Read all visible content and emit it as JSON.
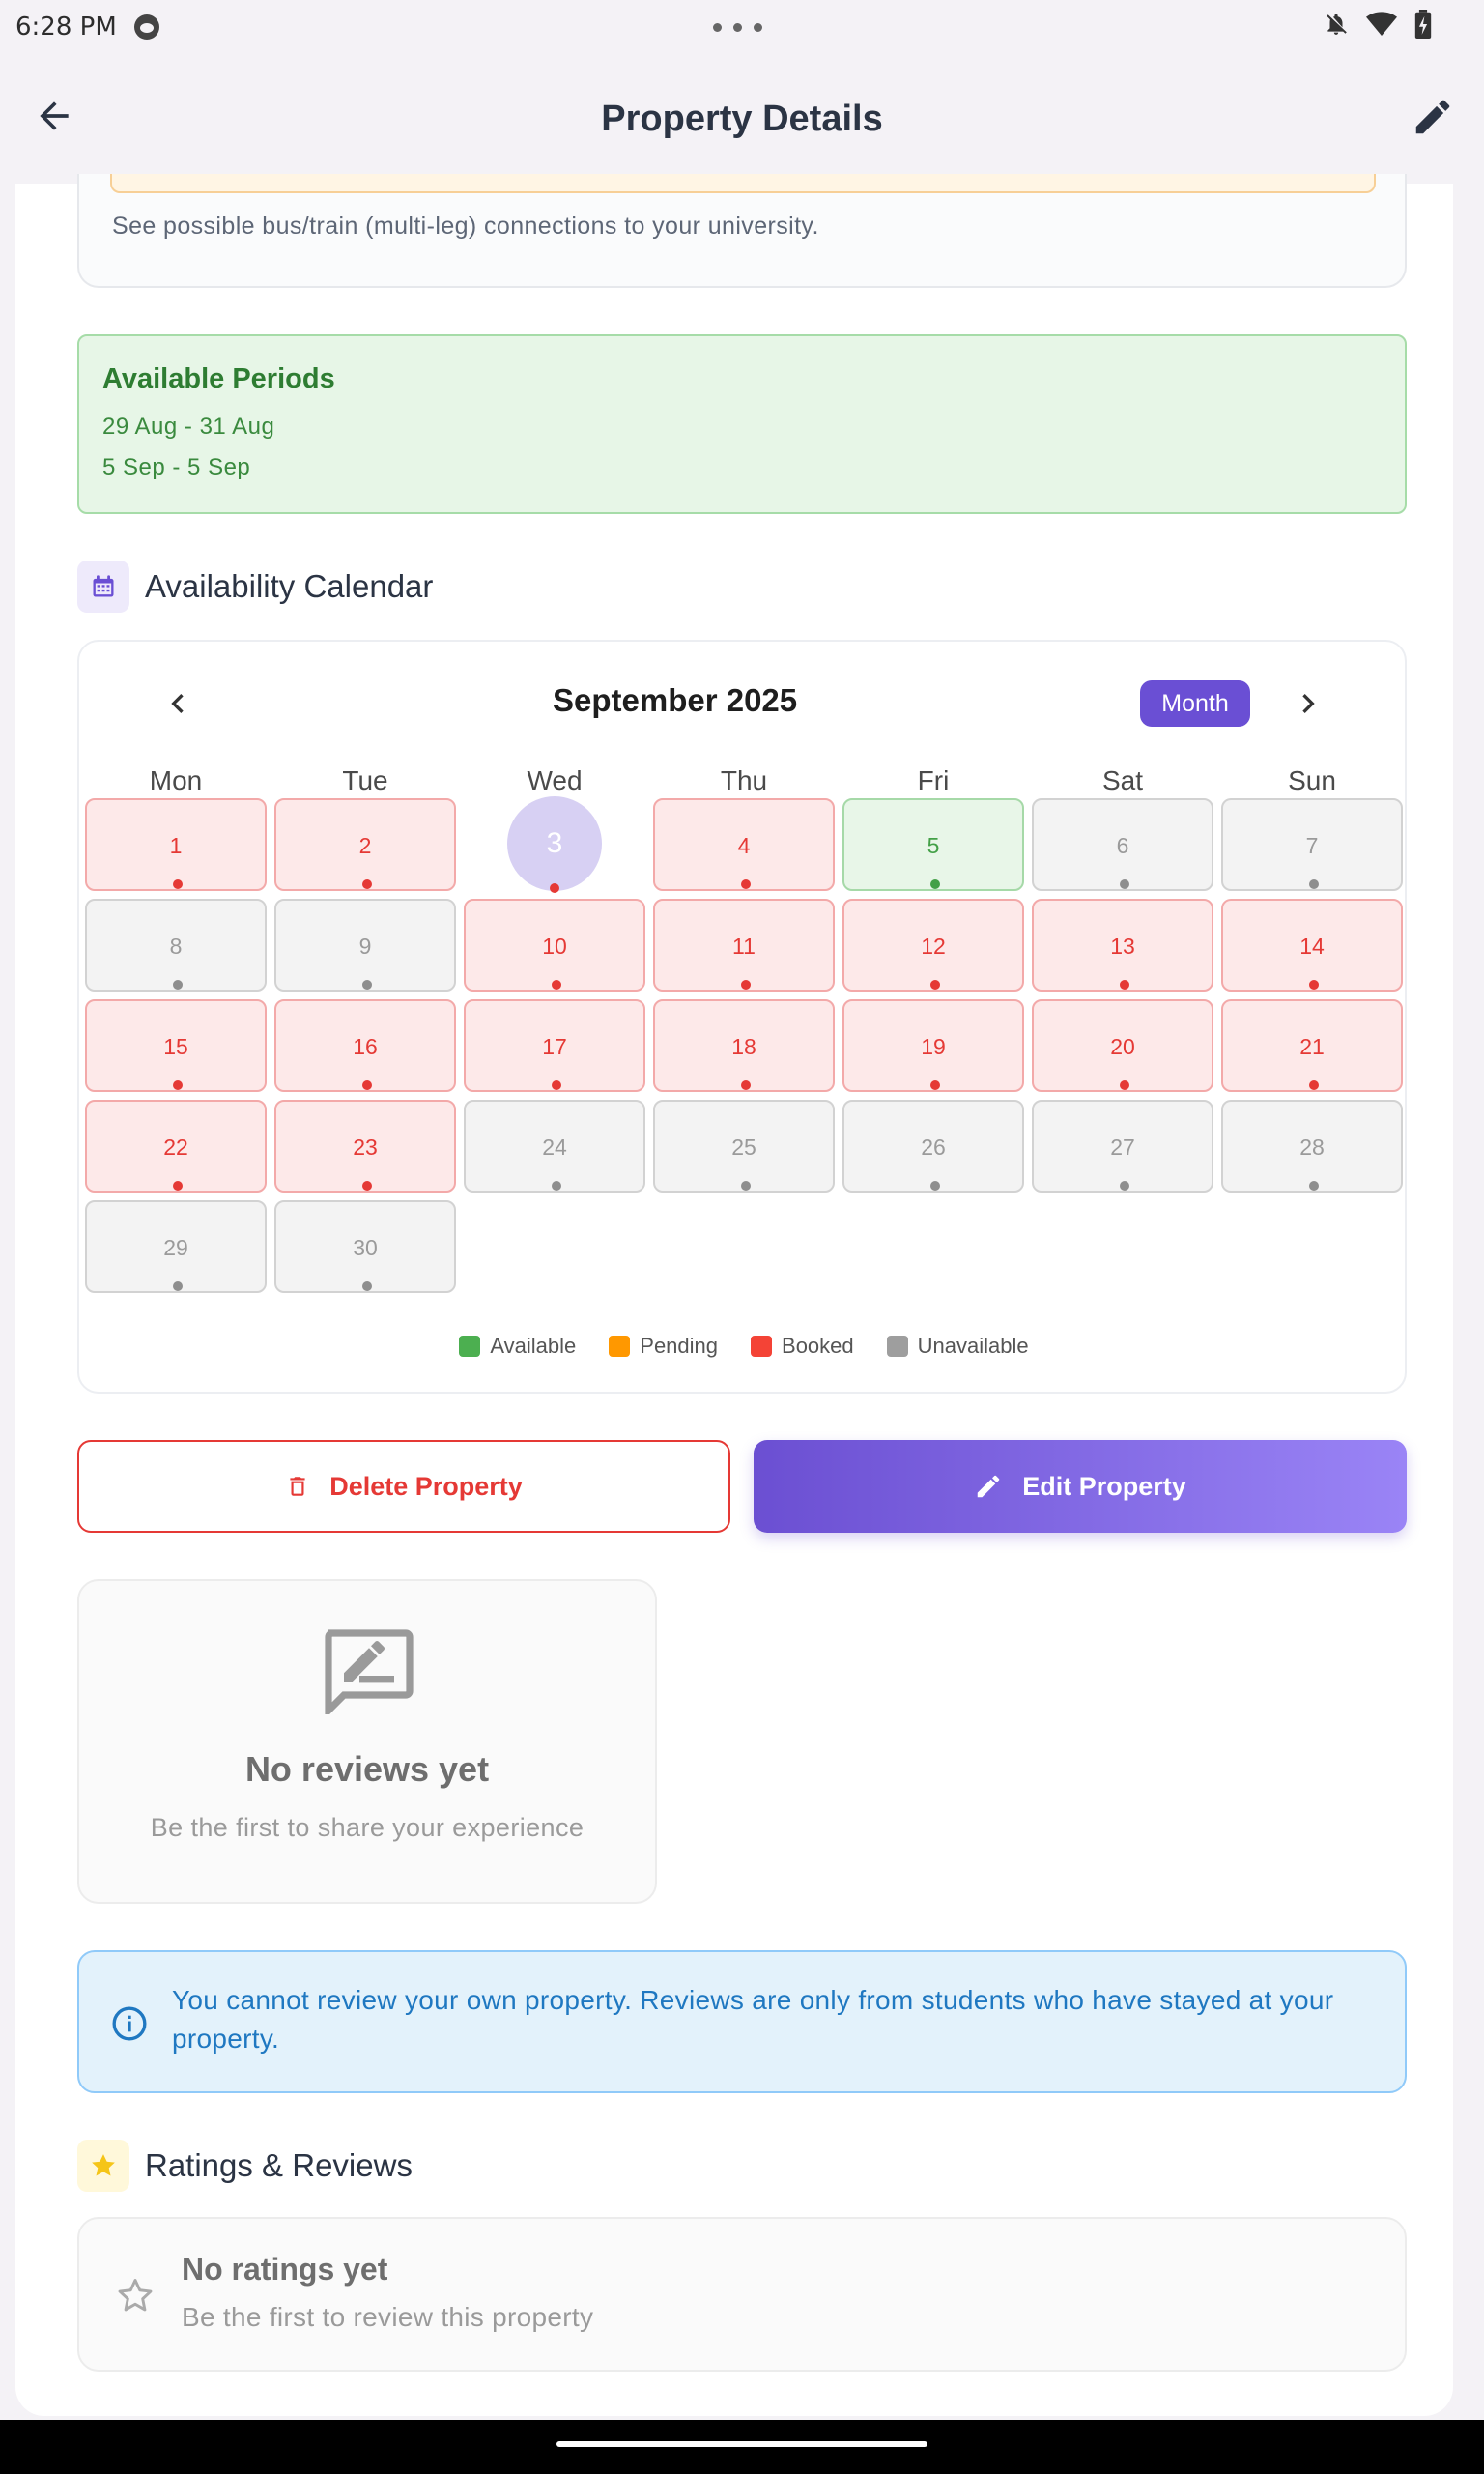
{
  "status_bar": {
    "time": "6:28 PM"
  },
  "app_bar": {
    "title": "Property Details"
  },
  "transit": {
    "text": "See possible bus/train (multi-leg) connections to your university."
  },
  "periods": {
    "title": "Available Periods",
    "items": [
      "29 Aug - 31 Aug",
      "5 Sep - 5 Sep"
    ]
  },
  "calendar": {
    "section_title": "Availability Calendar",
    "month_label": "September 2025",
    "mode_label": "Month",
    "weekdays": [
      "Mon",
      "Tue",
      "Wed",
      "Thu",
      "Fri",
      "Sat",
      "Sun"
    ],
    "days": [
      {
        "label": "1",
        "status": "booked"
      },
      {
        "label": "2",
        "status": "booked"
      },
      {
        "label": "3",
        "status": "today"
      },
      {
        "label": "4",
        "status": "booked"
      },
      {
        "label": "5",
        "status": "available"
      },
      {
        "label": "6",
        "status": "unavailable"
      },
      {
        "label": "7",
        "status": "unavailable"
      },
      {
        "label": "8",
        "status": "unavailable"
      },
      {
        "label": "9",
        "status": "unavailable"
      },
      {
        "label": "10",
        "status": "booked"
      },
      {
        "label": "11",
        "status": "booked"
      },
      {
        "label": "12",
        "status": "booked"
      },
      {
        "label": "13",
        "status": "booked"
      },
      {
        "label": "14",
        "status": "booked"
      },
      {
        "label": "15",
        "status": "booked"
      },
      {
        "label": "16",
        "status": "booked"
      },
      {
        "label": "17",
        "status": "booked"
      },
      {
        "label": "18",
        "status": "booked"
      },
      {
        "label": "19",
        "status": "booked"
      },
      {
        "label": "20",
        "status": "booked"
      },
      {
        "label": "21",
        "status": "booked"
      },
      {
        "label": "22",
        "status": "booked"
      },
      {
        "label": "23",
        "status": "booked"
      },
      {
        "label": "24",
        "status": "unavailable"
      },
      {
        "label": "25",
        "status": "unavailable"
      },
      {
        "label": "26",
        "status": "unavailable"
      },
      {
        "label": "27",
        "status": "unavailable"
      },
      {
        "label": "28",
        "status": "unavailable"
      },
      {
        "label": "29",
        "status": "unavailable"
      },
      {
        "label": "30",
        "status": "unavailable"
      }
    ],
    "legend": [
      {
        "label": "Available",
        "color": "#4caf50"
      },
      {
        "label": "Pending",
        "color": "#ff9800"
      },
      {
        "label": "Booked",
        "color": "#f44336"
      },
      {
        "label": "Unavailable",
        "color": "#9e9e9e"
      }
    ]
  },
  "actions": {
    "delete_label": "Delete Property",
    "edit_label": "Edit Property"
  },
  "reviews": {
    "title": "No reviews yet",
    "subtitle": "Be the first to share your experience"
  },
  "info": {
    "text": "You cannot review your own property. Reviews are only from students who have stayed at your property."
  },
  "ratings": {
    "section_title": "Ratings & Reviews",
    "title": "No ratings yet",
    "subtitle": "Be the first to review this property"
  },
  "colors": {
    "accent": "#6a4fd4",
    "booked": "#e53935",
    "available": "#43a047",
    "unavailable": "#9e9e9e",
    "info": "#1f78c1"
  }
}
